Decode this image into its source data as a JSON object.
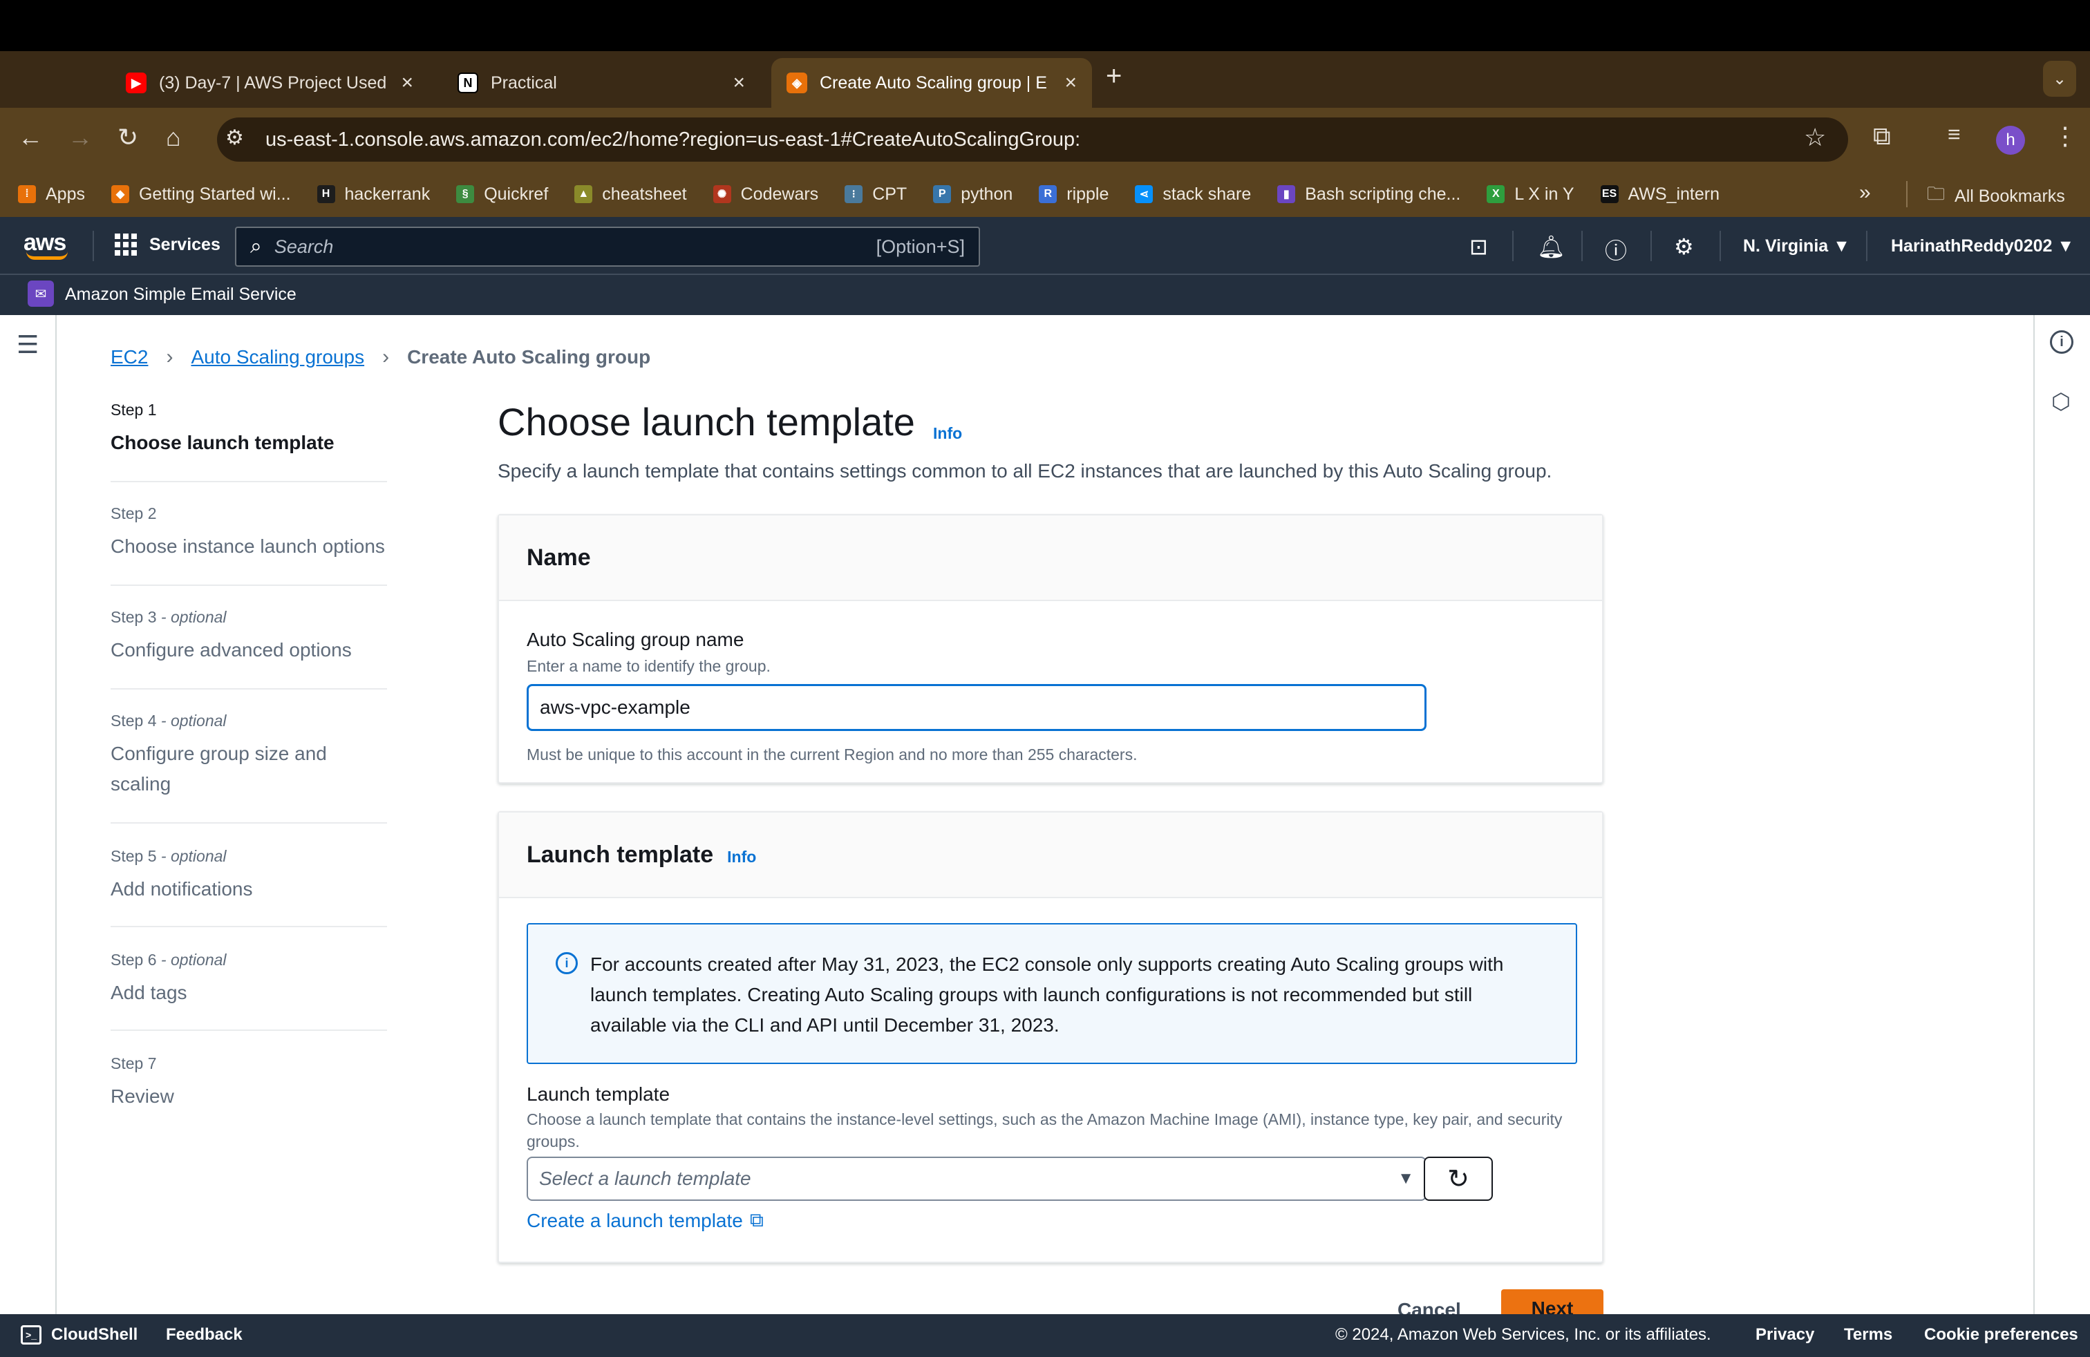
{
  "browser": {
    "tabs": [
      {
        "title": "(3) Day-7 | AWS Project Used",
        "favicon": "youtube-icon"
      },
      {
        "title": "Practical",
        "favicon": "notion-icon"
      },
      {
        "title": "Create Auto Scaling group | E",
        "favicon": "aws-icon"
      }
    ],
    "url": "us-east-1.console.aws.amazon.com/ec2/home?region=us-east-1#CreateAutoScalingGroup:",
    "profile_initial": "h",
    "bookmarks": [
      {
        "label": "Apps",
        "icon": "apps-grid-icon",
        "color": "#e8710a"
      },
      {
        "label": "Getting Started wi...",
        "icon": "package-icon",
        "color": "#e8710a"
      },
      {
        "label": "hackerrank",
        "icon": "hackerrank-icon",
        "color": "#1d1d1d"
      },
      {
        "label": "Quickref",
        "icon": "quickref-icon",
        "color": "#3d8b40"
      },
      {
        "label": "cheatsheet",
        "icon": "cheatsheet-icon",
        "color": "#8a8a2a"
      },
      {
        "label": "Codewars",
        "icon": "codewars-icon",
        "color": "#b1361e"
      },
      {
        "label": "CPT",
        "icon": "cisco-icon",
        "color": "#4a7a9c"
      },
      {
        "label": "python",
        "icon": "python-icon",
        "color": "#3776ab"
      },
      {
        "label": "ripple",
        "icon": "ripple-icon",
        "color": "#3b6fd6"
      },
      {
        "label": "stack share",
        "icon": "stackshare-icon",
        "color": "#0690fa"
      },
      {
        "label": "Bash scripting che...",
        "icon": "bookmark-icon",
        "color": "#6b46c1"
      },
      {
        "label": "L X in Y",
        "icon": "lxiny-icon",
        "color": "#2e9e3e"
      },
      {
        "label": "AWS_intern",
        "icon": "es-icon",
        "color": "#111111"
      }
    ],
    "bookmarks_more": "»",
    "all_bookmarks": "All Bookmarks"
  },
  "aws_nav": {
    "logo": "aws",
    "services": "Services",
    "search_placeholder": "Search",
    "search_shortcut": "[Option+S]",
    "region": "N. Virginia ▼",
    "account": "HarinathReddy0202 ▼",
    "service_label": "Amazon Simple Email Service"
  },
  "breadcrumb": {
    "items": [
      "EC2",
      "Auto Scaling groups"
    ],
    "current": "Create Auto Scaling group"
  },
  "steps": [
    {
      "number": "Step 1",
      "optional": "",
      "label": "Choose launch template",
      "current": true
    },
    {
      "number": "Step 2",
      "optional": "",
      "label": "Choose instance launch options"
    },
    {
      "number": "Step 3",
      "optional": " - optional",
      "label": "Configure advanced options"
    },
    {
      "number": "Step 4",
      "optional": " - optional",
      "label": "Configure group size and scaling"
    },
    {
      "number": "Step 5",
      "optional": " - optional",
      "label": "Add notifications"
    },
    {
      "number": "Step 6",
      "optional": " - optional",
      "label": "Add tags"
    },
    {
      "number": "Step 7",
      "optional": "",
      "label": "Review"
    }
  ],
  "main": {
    "title": "Choose launch template",
    "info": "Info",
    "description": "Specify a launch template that contains settings common to all EC2 instances that are launched by this Auto Scaling group.",
    "name_section": {
      "heading": "Name",
      "field_label": "Auto Scaling group name",
      "field_description": "Enter a name to identify the group.",
      "value": "aws-vpc-example",
      "constraint": "Must be unique to this account in the current Region and no more than 255 characters."
    },
    "launch_section": {
      "heading": "Launch template",
      "info": "Info",
      "alert": "For accounts created after May 31, 2023, the EC2 console only supports creating Auto Scaling groups with launch templates. Creating Auto Scaling groups with launch configurations is not recommended but still available via the CLI and API until December 31, 2023.",
      "field_label": "Launch template",
      "field_description": "Choose a launch template that contains the instance-level settings, such as the Amazon Machine Image (AMI), instance type, key pair, and security groups.",
      "select_placeholder": "Select a launch template",
      "create_link": "Create a launch template"
    },
    "cancel": "Cancel",
    "next": "Next"
  },
  "footer": {
    "cloudshell": "CloudShell",
    "feedback": "Feedback",
    "copyright": "© 2024, Amazon Web Services, Inc. or its affiliates.",
    "links": [
      "Privacy",
      "Terms",
      "Cookie preferences"
    ]
  },
  "colors": {
    "aws_nav_bg": "#232f3e",
    "link": "#0972d3",
    "primary_button": "#ec7211",
    "browser_chrome": "#59421f"
  }
}
